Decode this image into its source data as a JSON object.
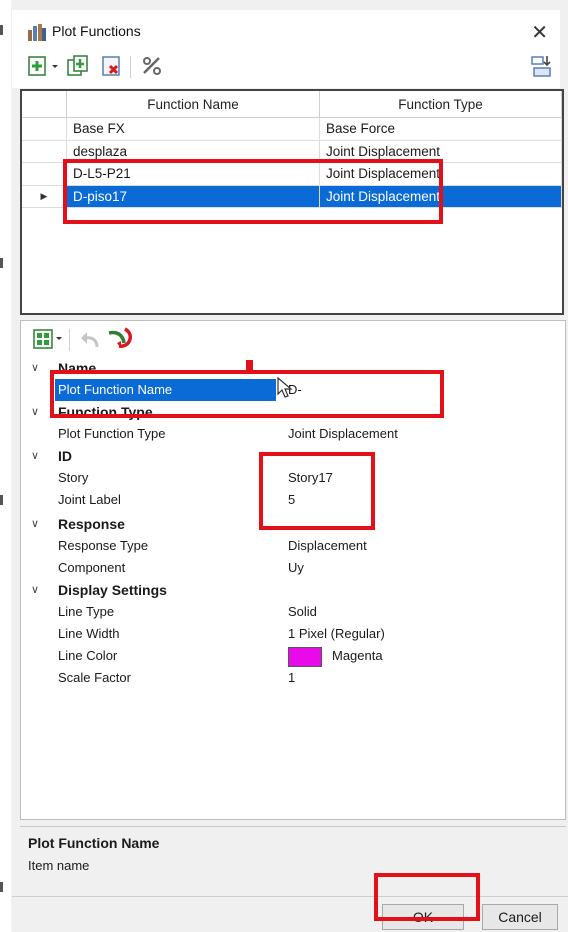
{
  "window": {
    "title": "Plot Functions",
    "close_icon": "close-icon"
  },
  "toolbar": {
    "icons": [
      "add-function-icon",
      "dropdown-arrow-icon",
      "copy-function-icon",
      "delete-function-icon",
      "modify-icon",
      "import-export-icon"
    ]
  },
  "grid": {
    "columns": [
      "Function Name",
      "Function Type"
    ],
    "rows": [
      {
        "name": "Base FX",
        "type": "Base Force"
      },
      {
        "name": "desplaza",
        "type": "Joint Displacement"
      },
      {
        "name": "D-L5-P21",
        "type": "Joint Displacement"
      },
      {
        "name": "D-piso17",
        "type": "Joint Displacement",
        "selected": true
      }
    ]
  },
  "properties": {
    "categories": {
      "name": "Name",
      "function_type": "Function Type",
      "id": "ID",
      "response": "Response",
      "display": "Display Settings"
    },
    "plot_function_name": {
      "label": "Plot Function Name",
      "value": "D-"
    },
    "plot_function_type": {
      "label": "Plot Function Type",
      "value": "Joint Displacement"
    },
    "story": {
      "label": "Story",
      "value": "Story17"
    },
    "joint_label": {
      "label": "Joint Label",
      "value": "5"
    },
    "response_type": {
      "label": "Response Type",
      "value": "Displacement"
    },
    "component": {
      "label": "Component",
      "value": "Uy"
    },
    "line_type": {
      "label": "Line Type",
      "value": "Solid"
    },
    "line_width": {
      "label": "Line Width",
      "value": "1 Pixel (Regular)"
    },
    "line_color": {
      "label": "Line Color",
      "value": "Magenta",
      "color": "#e80ae8"
    },
    "scale_factor": {
      "label": "Scale Factor",
      "value": "1"
    }
  },
  "description": {
    "title": "Plot Function Name",
    "text": "Item name"
  },
  "buttons": {
    "ok": "OK",
    "cancel": "Cancel"
  },
  "colors": {
    "selection": "#0a6ad6",
    "highlight_box": "#e3101a"
  }
}
